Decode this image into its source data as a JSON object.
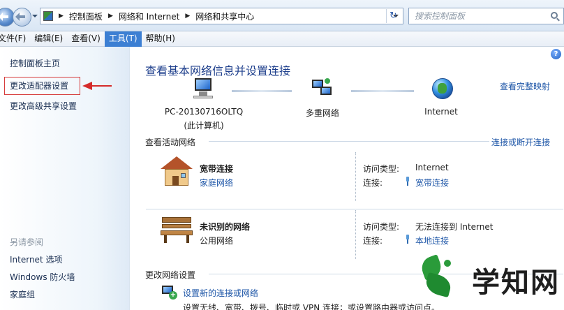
{
  "addressbar": {
    "breadcrumbs": [
      "控制面板",
      "网络和 Internet",
      "网络和共享中心"
    ],
    "search_placeholder": "搜索控制面板"
  },
  "menubar": {
    "items": [
      {
        "label": "文件(F)",
        "active": false
      },
      {
        "label": "编辑(E)",
        "active": false
      },
      {
        "label": "查看(V)",
        "active": false
      },
      {
        "label": "工具(T)",
        "active": true
      },
      {
        "label": "帮助(H)",
        "active": false
      }
    ]
  },
  "leftpane": {
    "home": "控制面板主页",
    "change_adapter": "更改适配器设置",
    "advanced_sharing": "更改高级共享设置",
    "see_also": "另请参阅",
    "links": [
      "Internet 选项",
      "Windows 防火墙",
      "家庭组"
    ]
  },
  "main": {
    "title": "查看基本网络信息并设置连接",
    "full_map": "查看完整映射",
    "nodes": {
      "pc_name": "PC-20130716OLTQ",
      "pc_sub": "(此计算机)",
      "multi": "多重网络",
      "internet": "Internet"
    },
    "active_networks_heading": "查看活动网络",
    "connect_disconnect": "连接或断开连接",
    "networks": [
      {
        "name": "宽带连接",
        "category": "家庭网络",
        "access_type_label": "访问类型:",
        "access_type": "Internet",
        "connections_label": "连接:",
        "connection": "宽带连接"
      },
      {
        "name": "未识别的网络",
        "category": "公用网络",
        "access_type_label": "访问类型:",
        "access_type": "无法连接到 Internet",
        "connections_label": "连接:",
        "connection": "本地连接"
      }
    ],
    "change_settings_heading": "更改网络设置",
    "setup_link": "设置新的连接或网络",
    "setup_desc": "设置无线、宽带、拨号、临时或 VPN 连接；或设置路由器或访问点。"
  },
  "watermark": {
    "text": "学知网"
  },
  "colors": {
    "link": "#1f57a8",
    "title": "#1e3f8c",
    "annotation_red": "#d52a2a",
    "menu_active": "#3c7fd3"
  }
}
